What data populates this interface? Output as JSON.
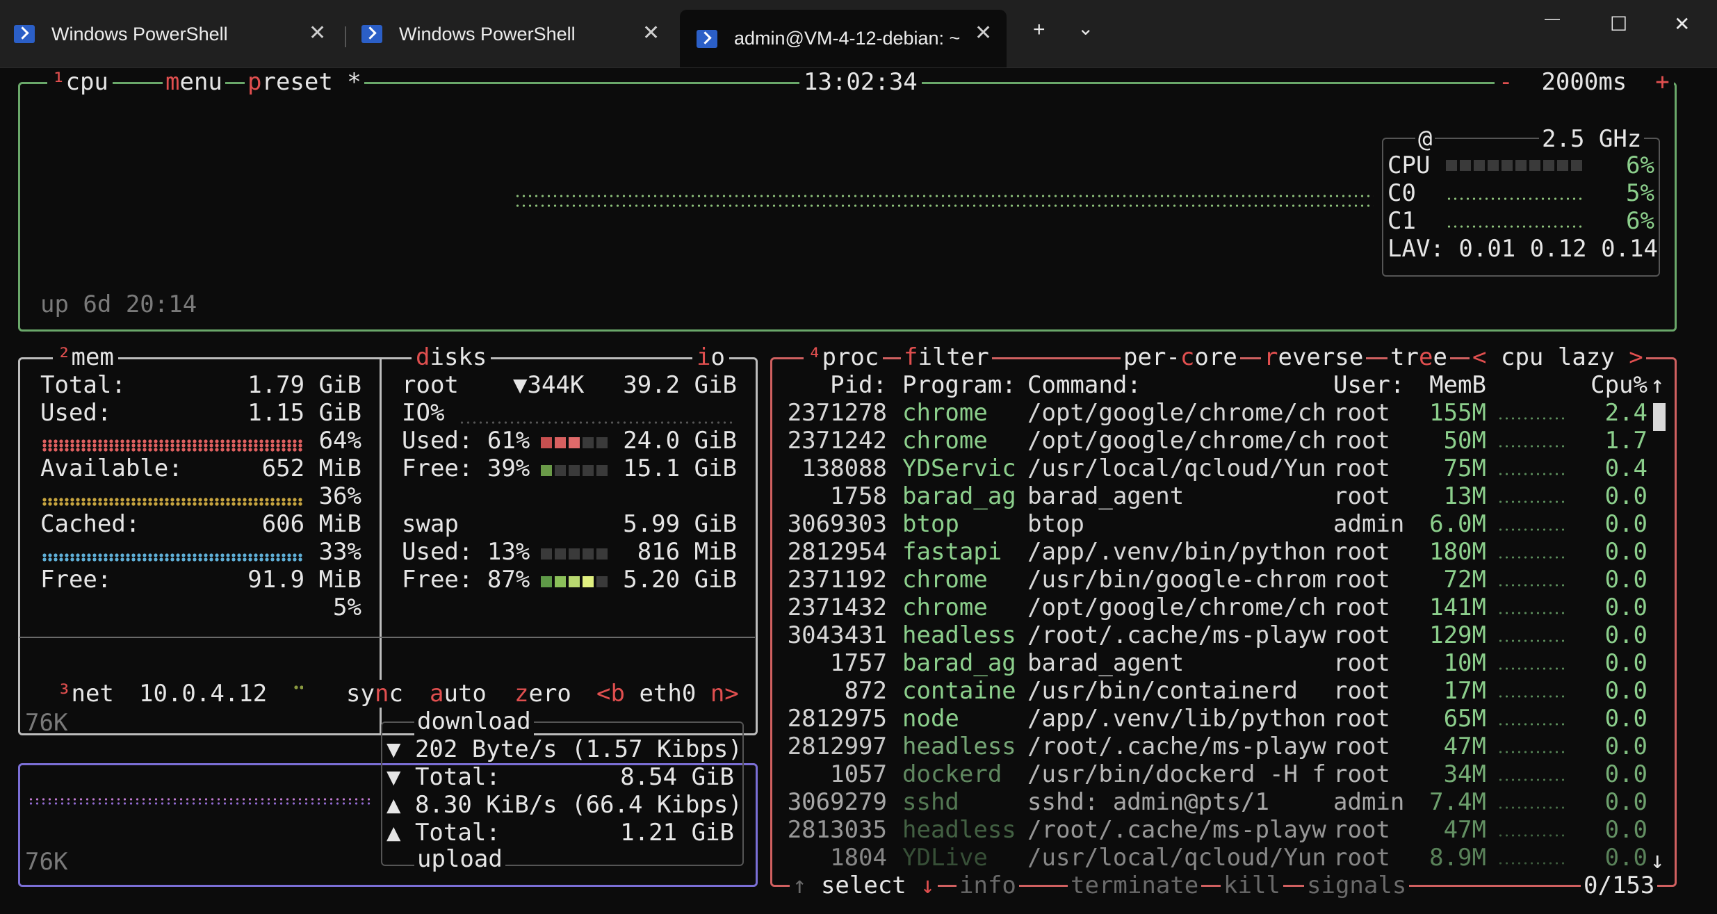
{
  "tabs": [
    {
      "label": "Windows PowerShell"
    },
    {
      "label": "Windows PowerShell"
    },
    {
      "label": "admin@VM-4-12-debian: ~"
    }
  ],
  "window_buttons": {
    "new_tab": "+",
    "dropdown": "⌄",
    "minimize": "—",
    "maximize": "☐",
    "close": "✕"
  },
  "cpu": {
    "num": "¹",
    "title": "cpu",
    "menu": "menu",
    "preset": "preset *",
    "clock": "13:02:34",
    "interval": "2000ms",
    "minus": "-",
    "plus": "+",
    "freq": "2.5 GHz",
    "at": "@",
    "rows": [
      {
        "label": "CPU",
        "pct": "6%"
      },
      {
        "label": "C0",
        "pct": "5%"
      },
      {
        "label": "C1",
        "pct": "6%"
      }
    ],
    "lav_label": "LAV:",
    "lav": "0.01 0.12 0.14",
    "uptime": "up 6d 20:14"
  },
  "mem": {
    "num": "²",
    "title": "mem",
    "total_label": "Total:",
    "total": "1.79 GiB",
    "used_label": "Used:",
    "used": "1.15 GiB",
    "used_pct": "64%",
    "avail_label": "Available:",
    "avail": "652 MiB",
    "avail_pct": "36%",
    "cached_label": "Cached:",
    "cached": "606 MiB",
    "cached_pct": "33%",
    "free_label": "Free:",
    "free": "91.9 MiB",
    "free_pct": "5%"
  },
  "disks": {
    "title": "disks",
    "io": "io",
    "root_label": "root",
    "root_io": "▼344K",
    "root_size": "39.2 GiB",
    "io_pct": "IO%",
    "used_label": "Used:",
    "used_pct": "61%",
    "used": "24.0 GiB",
    "free_label": "Free:",
    "free_pct": "39%",
    "free": "15.1 GiB",
    "swap_label": "swap",
    "swap_size": "5.99 GiB",
    "swap_used_label": "Used:",
    "swap_used_pct": "13%",
    "swap_used": "816 MiB",
    "swap_free_label": "Free:",
    "swap_free_pct": "87%",
    "swap_free": "5.20 GiB"
  },
  "net": {
    "num": "³",
    "title": "net",
    "ip": "10.0.4.12",
    "sync": "sync",
    "auto": "auto",
    "zero": "zero",
    "prev": "<b",
    "iface": "eth0",
    "next": "n>",
    "scale_top": "76K",
    "scale_bottom": "76K",
    "download": "download",
    "dl_rate": "202 Byte/s (1.57 Kibps)",
    "dl_total_label": "Total:",
    "dl_total": "8.54 GiB",
    "ul_rate": "8.30 KiB/s (66.4 Kibps)",
    "ul_total_label": "Total:",
    "ul_total": "1.21 GiB",
    "upload": "upload"
  },
  "proc": {
    "num": "⁴",
    "title": "proc",
    "filter": "filter",
    "per_core": "per-core",
    "reverse": "reverse",
    "tree": "tree",
    "lt": "<",
    "sort": "cpu lazy",
    "gt": ">",
    "headers": {
      "pid": "Pid:",
      "program": "Program:",
      "command": "Command:",
      "user": "User:",
      "mem": "MemB",
      "cpu": "Cpu%"
    },
    "rows": [
      {
        "pid": "2371278",
        "program": "chrome",
        "command": "/opt/google/chrome/ch",
        "user": "root",
        "mem": "155M",
        "cpu": "2.4"
      },
      {
        "pid": "2371242",
        "program": "chrome",
        "command": "/opt/google/chrome/ch",
        "user": "root",
        "mem": "50M",
        "cpu": "1.7"
      },
      {
        "pid": "138088",
        "program": "YDServic",
        "command": "/usr/local/qcloud/Yun",
        "user": "root",
        "mem": "75M",
        "cpu": "0.4"
      },
      {
        "pid": "1758",
        "program": "barad_ag",
        "command": "barad_agent",
        "user": "root",
        "mem": "13M",
        "cpu": "0.0"
      },
      {
        "pid": "3069303",
        "program": "btop",
        "command": "btop",
        "user": "admin",
        "mem": "6.0M",
        "cpu": "0.0"
      },
      {
        "pid": "2812954",
        "program": "fastapi",
        "command": "/app/.venv/bin/python",
        "user": "root",
        "mem": "180M",
        "cpu": "0.0"
      },
      {
        "pid": "2371192",
        "program": "chrome",
        "command": "/usr/bin/google-chrom",
        "user": "root",
        "mem": "72M",
        "cpu": "0.0"
      },
      {
        "pid": "2371432",
        "program": "chrome",
        "command": "/opt/google/chrome/ch",
        "user": "root",
        "mem": "141M",
        "cpu": "0.0"
      },
      {
        "pid": "3043431",
        "program": "headless",
        "command": "/root/.cache/ms-playw",
        "user": "root",
        "mem": "129M",
        "cpu": "0.0"
      },
      {
        "pid": "1757",
        "program": "barad_ag",
        "command": "barad_agent",
        "user": "root",
        "mem": "10M",
        "cpu": "0.0"
      },
      {
        "pid": "872",
        "program": "containe",
        "command": "/usr/bin/containerd",
        "user": "root",
        "mem": "17M",
        "cpu": "0.0"
      },
      {
        "pid": "2812975",
        "program": "node",
        "command": "/app/.venv/lib/python",
        "user": "root",
        "mem": "65M",
        "cpu": "0.0"
      },
      {
        "pid": "2812997",
        "program": "headless",
        "command": "/root/.cache/ms-playw",
        "user": "root",
        "mem": "47M",
        "cpu": "0.0"
      },
      {
        "pid": "1057",
        "program": "dockerd",
        "command": "/usr/bin/dockerd -H f",
        "user": "root",
        "mem": "34M",
        "cpu": "0.0"
      },
      {
        "pid": "3069279",
        "program": "sshd",
        "command": "sshd: admin@pts/1",
        "user": "admin",
        "mem": "7.4M",
        "cpu": "0.0"
      },
      {
        "pid": "2813035",
        "program": "headless",
        "command": "/root/.cache/ms-playw",
        "user": "root",
        "mem": "47M",
        "cpu": "0.0"
      },
      {
        "pid": "1804",
        "program": "YDLive",
        "command": "/usr/local/qcloud/Yun",
        "user": "root",
        "mem": "8.9M",
        "cpu": "0.0"
      }
    ],
    "footer": {
      "select": "↑ select ↓",
      "info": "info",
      "terminate": "terminate",
      "kill": "kill",
      "signals": "signals",
      "count": "0/153"
    }
  },
  "colors": {
    "cpu_box": "#6aa86a",
    "mem_box": "#c9c9c9",
    "net_box": "#7b6fd6",
    "proc_box": "#d06060",
    "accent_red": "#e04f4f",
    "green": "#8ccf8c"
  }
}
